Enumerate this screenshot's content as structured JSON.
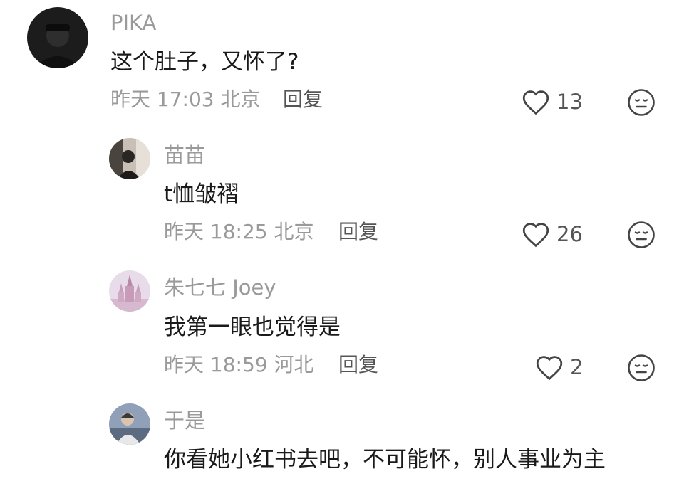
{
  "comments": [
    {
      "username": "PIKA",
      "content": "这个肚子，又怀了?",
      "time": "昨天 17:03",
      "location": "北京",
      "reply_label": "回复",
      "likes": "13"
    },
    {
      "username": "苗苗",
      "content": "t恤皱褶",
      "time": "昨天 18:25",
      "location": "北京",
      "reply_label": "回复",
      "likes": "26"
    },
    {
      "username": "朱七七 Joey",
      "content": "我第一眼也觉得是",
      "time": "昨天 18:59",
      "location": "河北",
      "reply_label": "回复",
      "likes": "2"
    },
    {
      "username": "于是",
      "content": "你看她小红书去吧，不可能怀，别人事业为主"
    }
  ],
  "icons": {
    "like": "heart-outline-icon",
    "dislike": "neutral-face-icon"
  },
  "colors": {
    "text_primary": "#1a1a1a",
    "text_secondary": "#9a9a9a",
    "action": "#555555"
  }
}
